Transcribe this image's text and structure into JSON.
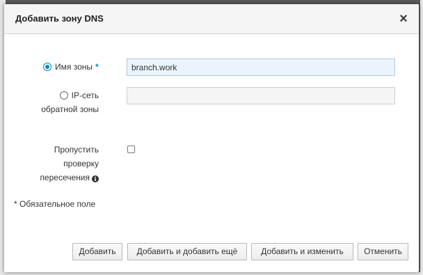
{
  "dialog": {
    "title": "Добавить зону DNS",
    "close_glyph": "×"
  },
  "form": {
    "zone_name": {
      "label": "Имя зоны",
      "required_mark": "*",
      "value": "branch.work",
      "selected": true
    },
    "reverse_zone": {
      "label_line1": "IP-сеть",
      "label_line2": "обратной зоны",
      "value": "",
      "selected": false
    },
    "skip_overlap": {
      "label_line1": "Пропустить",
      "label_line2": "проверку",
      "label_line3": "пересечения",
      "info_icon": "info-icon",
      "checked": false
    },
    "required_note": "* Обязательное поле"
  },
  "buttons": {
    "add": "Добавить",
    "add_and_add_another": "Добавить и добавить ещё",
    "add_and_edit": "Добавить и изменить",
    "cancel": "Отменить"
  },
  "colors": {
    "accent": "#0088ce",
    "active_input_bg": "#ebf4fd",
    "header_bg": "#f5f5f5"
  }
}
